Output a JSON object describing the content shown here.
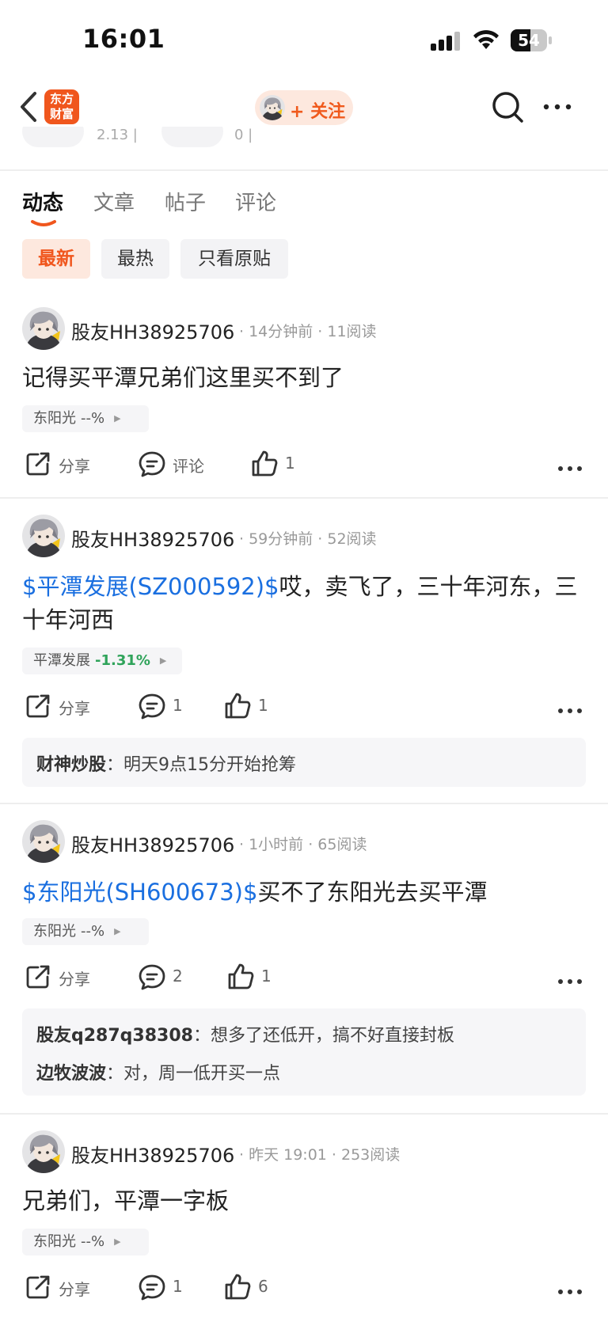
{
  "status": {
    "time": "16:01",
    "battery": "54"
  },
  "nav": {
    "logo_line1": "东方",
    "logo_line2": "财富",
    "follow_label": "+ 关注"
  },
  "peek": {
    "left_text": "2.13 |",
    "right_text": "0 |"
  },
  "tabs": [
    "动态",
    "文章",
    "帖子",
    "评论"
  ],
  "filters": [
    "最新",
    "最热",
    "只看原贴"
  ],
  "posts": [
    {
      "user": "股友HH38925706",
      "meta": "· 14分钟前 · 11阅读",
      "link": "",
      "text": "记得买平潭兄弟们这里买不到了",
      "stock_name": "东阳光",
      "stock_change": "--%",
      "share": "分享",
      "comment": "评论",
      "likes": "1"
    },
    {
      "user": "股友HH38925706",
      "meta": "· 59分钟前 · 52阅读",
      "link": "$平潭发展(SZ000592)$",
      "text": "哎，卖飞了，三十年河东，三十年河西",
      "stock_name": "平潭发展",
      "stock_change": "-1.31%",
      "share": "分享",
      "comment": "1",
      "likes": "1",
      "replies": [
        {
          "who": "财神炒股",
          "text": "：明天9点15分开始抢筹"
        }
      ]
    },
    {
      "user": "股友HH38925706",
      "meta": "· 1小时前 · 65阅读",
      "link": "$东阳光(SH600673)$",
      "text": "买不了东阳光去买平潭",
      "stock_name": "东阳光",
      "stock_change": "--%",
      "share": "分享",
      "comment": "2",
      "likes": "1",
      "replies": [
        {
          "who": "股友q287q38308",
          "text": "：想多了还低开，搞不好直接封板"
        },
        {
          "who": "边牧波波",
          "text": "：对，周一低开买一点"
        }
      ]
    },
    {
      "user": "股友HH38925706",
      "meta": "· 昨天 19:01 · 253阅读",
      "link": "",
      "text": "兄弟们，平潭一字板",
      "stock_name": "东阳光",
      "stock_change": "--%",
      "share": "分享",
      "comment": "1",
      "likes": "6"
    }
  ],
  "colors": {
    "accent": "#f0561d",
    "link": "#1a6fe0",
    "down": "#2fa35a"
  }
}
